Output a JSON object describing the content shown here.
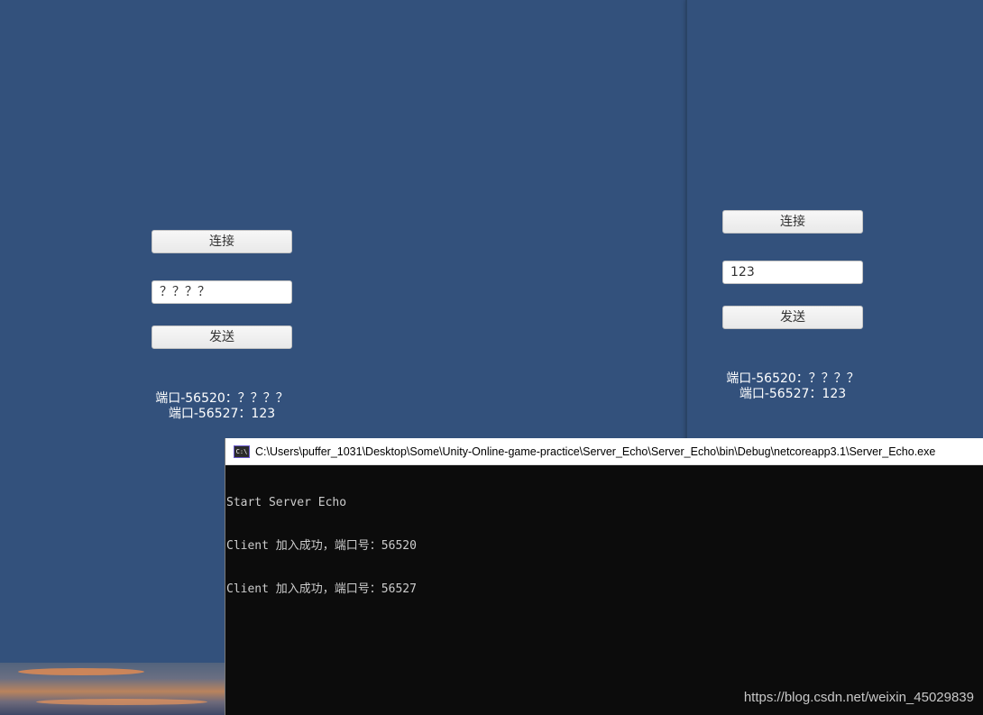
{
  "left_client": {
    "connect_label": "连接",
    "input_value": "？？？？",
    "send_label": "发送",
    "log": [
      "端口-56520：？？？？",
      "端口-56527：123"
    ]
  },
  "right_client": {
    "connect_label": "连接",
    "input_value": "123",
    "send_label": "发送",
    "log": [
      "端口-56520：？？？？",
      "端口-56527：123"
    ]
  },
  "console": {
    "icon": "C:\\",
    "title": "C:\\Users\\puffer_1031\\Desktop\\Some\\Unity-Online-game-practice\\Server_Echo\\Server_Echo\\bin\\Debug\\netcoreapp3.1\\Server_Echo.exe",
    "lines": [
      "Start Server Echo",
      "Client 加入成功，端口号：56520",
      "Client 加入成功，端口号：56527"
    ]
  },
  "watermark": "https://blog.csdn.net/weixin_45029839",
  "colors": {
    "game_background": "#33517c",
    "console_background": "#0c0c0c",
    "console_text": "#cccccc"
  }
}
